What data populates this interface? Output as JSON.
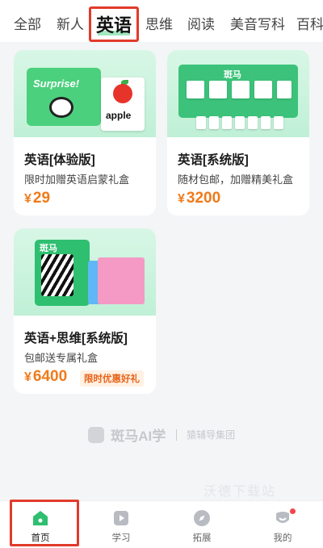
{
  "category_tabs": [
    {
      "label": "全部"
    },
    {
      "label": "新人"
    },
    {
      "label": "英语",
      "active": true
    },
    {
      "label": "思维"
    },
    {
      "label": "阅读"
    },
    {
      "label": "美音写科"
    },
    {
      "label": "百科"
    }
  ],
  "products": [
    {
      "title": "英语[体验版]",
      "subtitle": "限时加赠英语启蒙礼盒",
      "currency": "¥",
      "price": "29",
      "hero_texts": {
        "book": "Surprise!",
        "card": "apple"
      }
    },
    {
      "title": "英语[系统版]",
      "subtitle": "随材包邮，加赠精美礼盒",
      "currency": "¥",
      "price": "3200",
      "hero_texts": {
        "board": "斑马"
      }
    },
    {
      "title": "英语+思维[系统版]",
      "subtitle": "包邮送专属礼盒",
      "currency": "¥",
      "price": "6400",
      "promo": "限时优惠好礼",
      "hero_texts": {
        "box": "斑马"
      }
    }
  ],
  "brand": {
    "name": "斑马AI学",
    "group": "猿辅导集团"
  },
  "watermark": "沃德下载站",
  "bottom_nav": [
    {
      "label": "首页",
      "icon": "home-icon",
      "active": true
    },
    {
      "label": "学习",
      "icon": "play-icon"
    },
    {
      "label": "拓展",
      "icon": "compass-icon"
    },
    {
      "label": "我的",
      "icon": "profile-icon",
      "badge": true
    }
  ],
  "colors": {
    "accent": "#2fbf70",
    "price": "#f07a1a",
    "highlight": "#e23a2a"
  }
}
